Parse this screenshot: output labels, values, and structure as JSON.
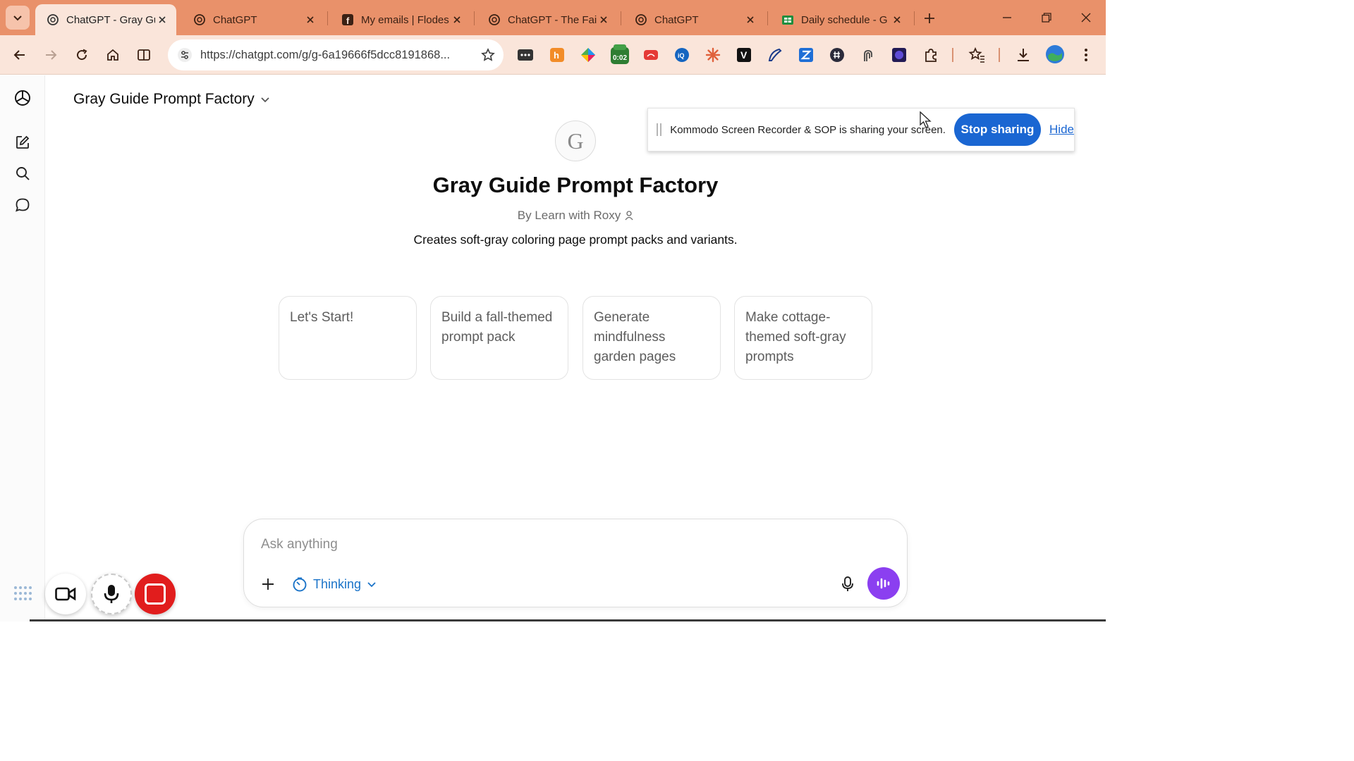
{
  "browser": {
    "tabs": [
      {
        "title": "ChatGPT - Gray Gu",
        "favicon": "chatgpt-icon",
        "active": true
      },
      {
        "title": "ChatGPT",
        "favicon": "chatgpt-icon",
        "active": false
      },
      {
        "title": "My emails | Flodes",
        "favicon": "facebook-icon",
        "active": false
      },
      {
        "title": "ChatGPT - The Fait",
        "favicon": "chatgpt-icon",
        "active": false
      },
      {
        "title": "ChatGPT",
        "favicon": "chatgpt-icon",
        "active": false
      },
      {
        "title": "Daily schedule - G",
        "favicon": "sheets-icon",
        "active": false
      }
    ],
    "url": "https://chatgpt.com/g/g-6a19666f5dcc8191868...",
    "extension_badge": "0:02",
    "colors": {
      "tabbar": "#e9916a",
      "toolbar": "#fae5da"
    }
  },
  "app": {
    "model_title": "Gray Guide Prompt Factory",
    "gpt": {
      "avatar_letter": "G",
      "name": "Gray Guide Prompt Factory",
      "author": "By Learn with Roxy",
      "description": "Creates soft-gray coloring page prompt packs and variants."
    },
    "starters": [
      "Let's Start!",
      "Build a fall-themed prompt pack",
      "Generate mindfulness garden pages",
      "Make cottage-themed soft-gray prompts"
    ],
    "composer": {
      "placeholder": "Ask anything",
      "mode_label": "Thinking"
    }
  },
  "share_banner": {
    "text": "Kommodo Screen Recorder & SOP is sharing your screen.",
    "stop_label": "Stop sharing",
    "hide_label": "Hide",
    "accent": "#1a66d2"
  }
}
